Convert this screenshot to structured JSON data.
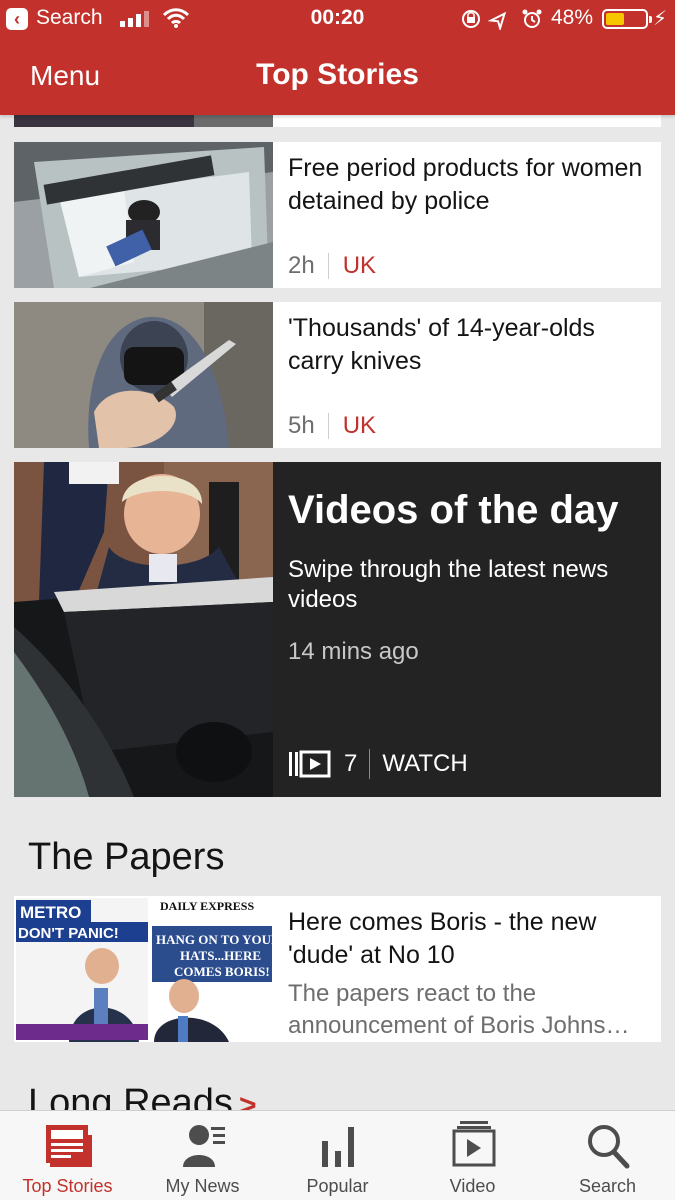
{
  "status_bar": {
    "back_label": "Search",
    "time": "00:20",
    "battery_percent": "48%",
    "battery_level": 0.48
  },
  "nav": {
    "menu_label": "Menu",
    "title": "Top Stories"
  },
  "stories": [
    {
      "headline": "Free period products for women detained by police",
      "age": "2h",
      "section": "UK"
    },
    {
      "headline": "'Thousands' of 14-year-olds carry knives",
      "age": "5h",
      "section": "UK"
    }
  ],
  "videos_of_the_day": {
    "title": "Videos of the day",
    "subtitle": "Swipe through the latest news videos",
    "age": "14 mins ago",
    "count": "7",
    "watch_label": "WATCH"
  },
  "papers": {
    "section_title": "The Papers",
    "headline": "Here comes Boris - the new 'dude' at No 10",
    "summary_line1": "The papers react to the",
    "summary_line2": "announcement of Boris Johns…",
    "cover1_masthead": "METRO",
    "cover1_headline": "DON'T PANIC!",
    "cover2_masthead": "DAILY EXPRESS",
    "cover2_headline": "HANG ON TO YOUR HATS...HERE COMES BORIS!"
  },
  "long_reads": {
    "section_title": "Long Reads"
  },
  "tabbar": {
    "tabs": [
      {
        "label": "Top Stories",
        "icon": "newspaper-icon",
        "active": true
      },
      {
        "label": "My News",
        "icon": "person-list-icon",
        "active": false
      },
      {
        "label": "Popular",
        "icon": "bar-chart-icon",
        "active": false
      },
      {
        "label": "Video",
        "icon": "video-stack-icon",
        "active": false
      },
      {
        "label": "Search",
        "icon": "magnifier-icon",
        "active": false
      }
    ]
  },
  "colors": {
    "brand_red": "#c2312b",
    "video_card_bg": "#232323",
    "battery_fill": "#f7c600"
  }
}
